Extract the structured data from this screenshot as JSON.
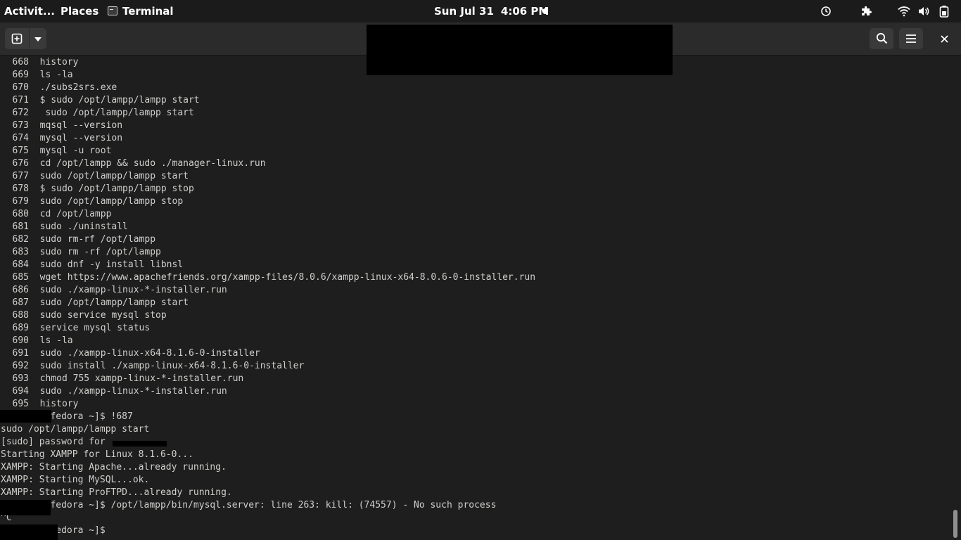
{
  "topbar": {
    "activities": "Activit...",
    "places": "Places",
    "app_name": "Terminal",
    "date": "Sun Jul 31",
    "time": "4:06 PM",
    "icons": [
      "clock-alarm-icon",
      "extensions-icon",
      "wifi-icon",
      "volume-icon",
      "battery-icon"
    ]
  },
  "header": {
    "new_tab_icon": "plus-square-icon",
    "menu_dropdown_icon": "chevron-down-icon",
    "search_icon": "search-icon",
    "hamburger_icon": "hamburger-menu-icon",
    "close_icon": "close-icon"
  },
  "terminal": {
    "history": [
      {
        "n": "668",
        "cmd": "history"
      },
      {
        "n": "669",
        "cmd": "ls -la"
      },
      {
        "n": "670",
        "cmd": "./subs2srs.exe"
      },
      {
        "n": "671",
        "cmd": "$ sudo /opt/lampp/lampp start"
      },
      {
        "n": "672",
        "cmd": " sudo /opt/lampp/lampp start"
      },
      {
        "n": "673",
        "cmd": "mqsql --version"
      },
      {
        "n": "674",
        "cmd": "mysql --version"
      },
      {
        "n": "675",
        "cmd": "mysql -u root"
      },
      {
        "n": "676",
        "cmd": "cd /opt/lampp && sudo ./manager-linux.run"
      },
      {
        "n": "677",
        "cmd": "sudo /opt/lampp/lampp start"
      },
      {
        "n": "678",
        "cmd": "$ sudo /opt/lampp/lampp stop"
      },
      {
        "n": "679",
        "cmd": "sudo /opt/lampp/lampp stop"
      },
      {
        "n": "680",
        "cmd": "cd /opt/lampp"
      },
      {
        "n": "681",
        "cmd": "sudo ./uninstall"
      },
      {
        "n": "682",
        "cmd": "sudo rm-rf /opt/lampp"
      },
      {
        "n": "683",
        "cmd": "sudo rm -rf /opt/lampp"
      },
      {
        "n": "684",
        "cmd": "sudo dnf -y install libnsl"
      },
      {
        "n": "685",
        "cmd": "wget https://www.apachefriends.org/xampp-files/8.0.6/xampp-linux-x64-8.0.6-0-installer.run"
      },
      {
        "n": "686",
        "cmd": "sudo ./xampp-linux-*-installer.run"
      },
      {
        "n": "687",
        "cmd": "sudo /opt/lampp/lampp start"
      },
      {
        "n": "688",
        "cmd": "sudo service mysql stop"
      },
      {
        "n": "689",
        "cmd": "service mysql status"
      },
      {
        "n": "690",
        "cmd": "ls -la"
      },
      {
        "n": "691",
        "cmd": "sudo ./xampp-linux-x64-8.1.6-0-installer"
      },
      {
        "n": "692",
        "cmd": "sudo install ./xampp-linux-x64-8.1.6-0-installer"
      },
      {
        "n": "693",
        "cmd": "chmod 755 xampp-linux-*-installer.run"
      },
      {
        "n": "694",
        "cmd": "sudo ./xampp-linux-*-installer.run"
      },
      {
        "n": "695",
        "cmd": "history"
      }
    ],
    "output": [
      "         fedora ~]$ !687",
      "sudo /opt/lampp/lampp start",
      "[sudo] password for",
      "Starting XAMPP for Linux 8.1.6-0...",
      "XAMPP: Starting Apache...already running.",
      "XAMPP: Starting MySQL...ok.",
      "XAMPP: Starting ProFTPD...already running.",
      "         fedora ~]$ /opt/lampp/bin/mysql.server: line 263: kill: (74557) - No such process",
      "^C",
      "          edora ~]$"
    ]
  }
}
